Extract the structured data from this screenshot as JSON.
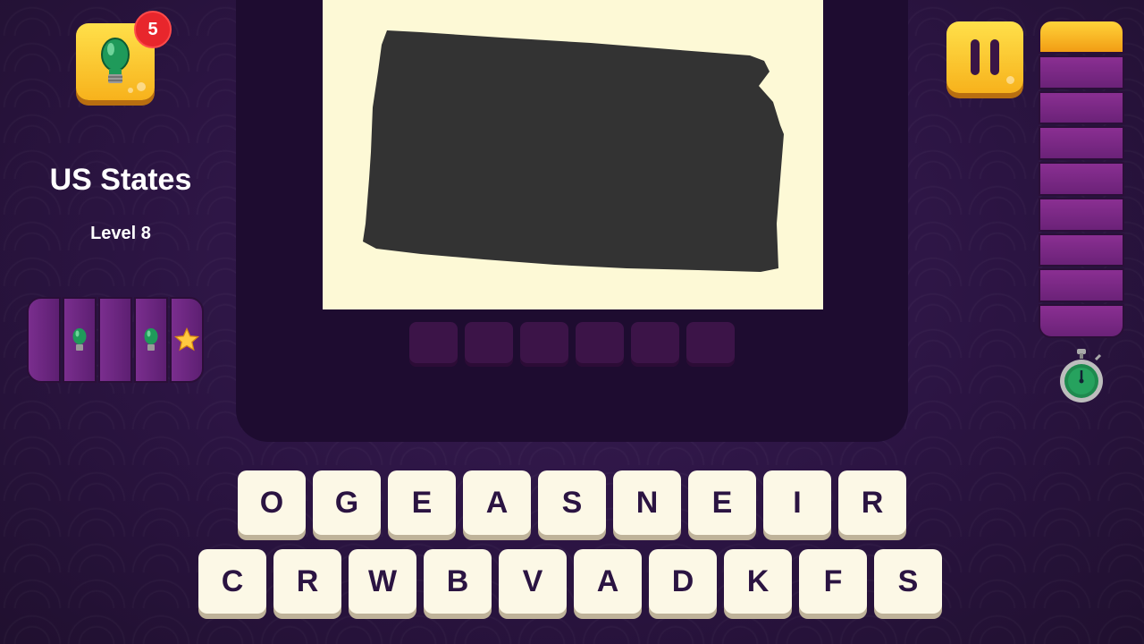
{
  "hint": {
    "count": "5"
  },
  "category": "US States",
  "level": "Level 8",
  "level_progress": [
    "empty",
    "bulb",
    "empty",
    "bulb",
    "star"
  ],
  "answer_slots": 6,
  "timer": {
    "segments": 9,
    "remaining_segments": 1
  },
  "keyboard": {
    "row1": [
      "O",
      "G",
      "E",
      "A",
      "S",
      "N",
      "E",
      "I",
      "R"
    ],
    "row2": [
      "C",
      "R",
      "W",
      "B",
      "V",
      "A",
      "D",
      "K",
      "F",
      "S"
    ]
  },
  "colors": {
    "accent": "#f7b21c",
    "bg": "#2b1442",
    "key": "#fcf8e6",
    "silhouette": "#333333"
  }
}
